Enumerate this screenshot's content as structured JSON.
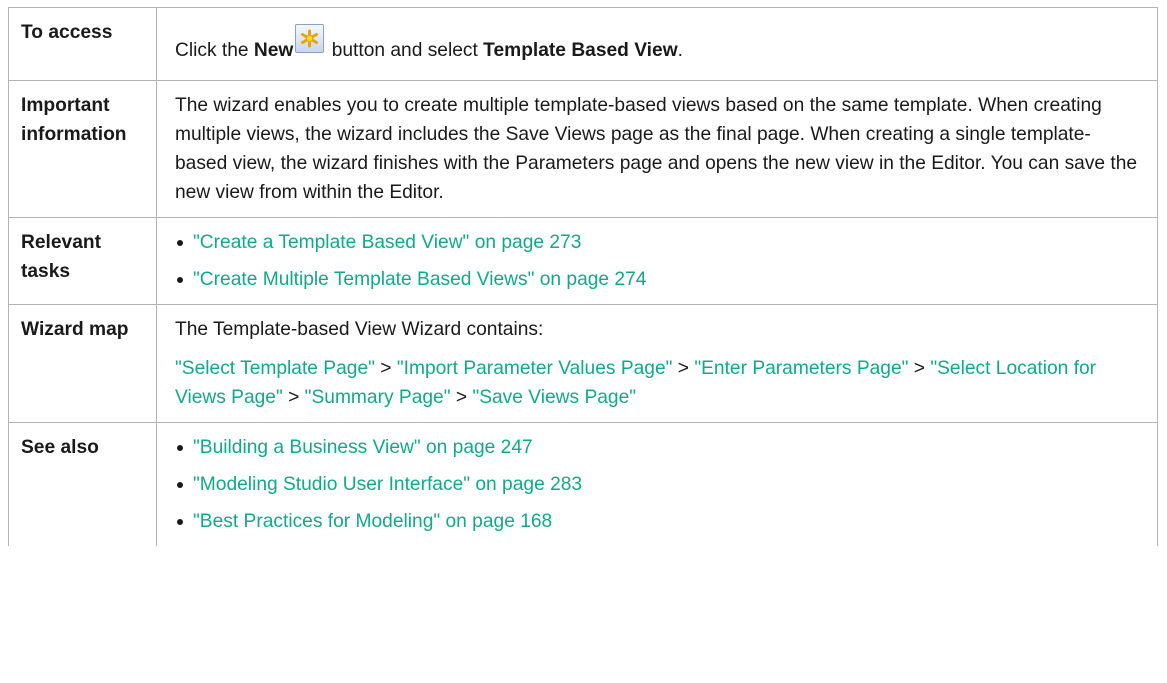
{
  "rows": {
    "access": {
      "label": "To access",
      "prefix": "Click the ",
      "new_bold": "New",
      "button_icon": "new-star-icon",
      "middle": " button and select ",
      "target_bold": "Template Based View",
      "suffix": "."
    },
    "important": {
      "label": "Important information",
      "text": "The wizard enables you to create multiple template-based views based on the same template. When creating multiple views, the wizard includes the Save Views page as the final page. When creating a single template-based view, the wizard finishes with the Parameters page and opens the new view in the Editor. You can save the new view from within the Editor."
    },
    "tasks": {
      "label": "Relevant tasks",
      "items": [
        "\"Create a Template Based View\" on page 273",
        "\"Create Multiple Template Based Views\" on page 274"
      ]
    },
    "wizard": {
      "label": "Wizard map",
      "intro": "The Template-based View Wizard contains:",
      "steps": [
        "\"Select Template Page\"",
        "\"Import Parameter Values Page\"",
        "\"Enter Parameters Page\"",
        "\"Select Location for Views Page\"",
        "\"Summary Page\"",
        "\"Save Views Page\""
      ],
      "separator": " > "
    },
    "see_also": {
      "label": "See also",
      "items": [
        "\"Building a Business View\" on page 247",
        "\"Modeling Studio User Interface\" on page 283",
        "\"Best Practices for Modeling\" on page 168"
      ]
    }
  },
  "colors": {
    "link": "#12a88a",
    "border": "#b3b3b3",
    "text": "#1a1a1a"
  }
}
